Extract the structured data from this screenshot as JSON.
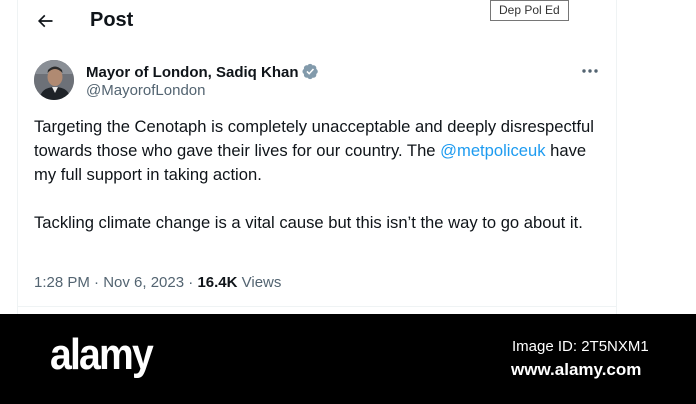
{
  "header": {
    "title": "Post",
    "back_icon": "arrow-left-icon"
  },
  "tooltip": {
    "text": "Dep Pol Ed"
  },
  "tweet": {
    "author": {
      "display_name": "Mayor of London, Sadiq Khan",
      "handle": "@MayorofLondon",
      "verified_icon": "verified-badge-icon",
      "verified_color": "#829aab"
    },
    "more_icon": "more-horizontal-icon",
    "text": {
      "paragraph1_part1": "Targeting the Cenotaph is completely unacceptable and deeply disrespectful towards those who gave their lives for our country.  The",
      "mention": "@metpoliceuk",
      "paragraph1_part2": "have my full support in taking action.",
      "paragraph2": "Tackling climate change is a vital cause but this isn’t the way to go about it."
    },
    "timestamp": "1:28 PM · Nov 6, 2023",
    "separator": "·",
    "views_count": "16.4K",
    "views_label": "Views"
  },
  "colors": {
    "link": "#1d9bf0",
    "secondary_text": "#536471",
    "primary_text": "#0f1419",
    "border": "#eff3f4"
  },
  "watermark": {
    "logo_text": "alamy",
    "image_id": "Image ID: 2T5NXM1",
    "site": "www.alamy.com"
  }
}
